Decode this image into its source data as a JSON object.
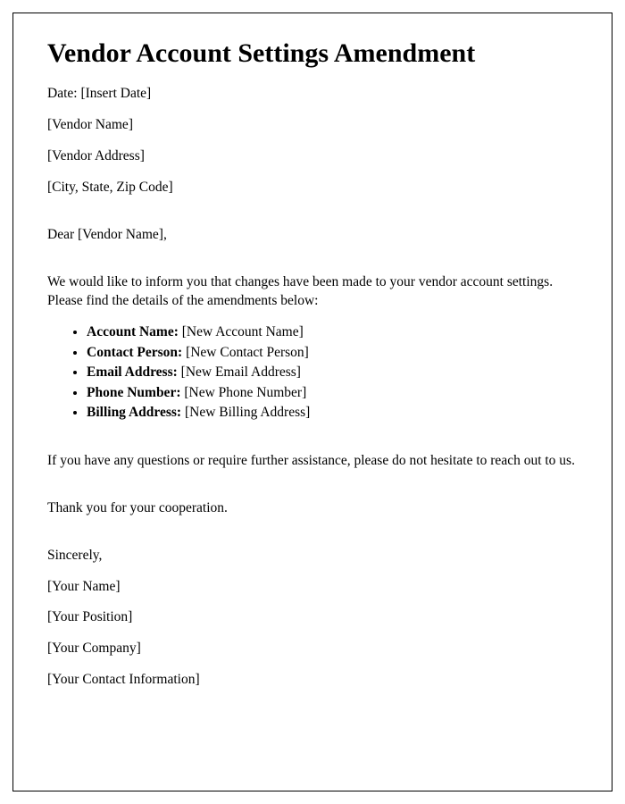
{
  "title": "Vendor Account Settings Amendment",
  "date_line": "Date: [Insert Date]",
  "vendor_name": "[Vendor Name]",
  "vendor_address": "[Vendor Address]",
  "vendor_city": "[City, State, Zip Code]",
  "salutation": "Dear [Vendor Name],",
  "intro": "We would like to inform you that changes have been made to your vendor account settings. Please find the details of the amendments below:",
  "items": [
    {
      "label": "Account Name:",
      "value": " [New Account Name]"
    },
    {
      "label": "Contact Person:",
      "value": " [New Contact Person]"
    },
    {
      "label": "Email Address:",
      "value": " [New Email Address]"
    },
    {
      "label": "Phone Number:",
      "value": " [New Phone Number]"
    },
    {
      "label": "Billing Address:",
      "value": " [New Billing Address]"
    }
  ],
  "assist": "If you have any questions or require further assistance, please do not hesitate to reach out to us.",
  "thanks": "Thank you for your cooperation.",
  "closing": "Sincerely,",
  "sig_name": "[Your Name]",
  "sig_position": "[Your Position]",
  "sig_company": "[Your Company]",
  "sig_contact": "[Your Contact Information]"
}
